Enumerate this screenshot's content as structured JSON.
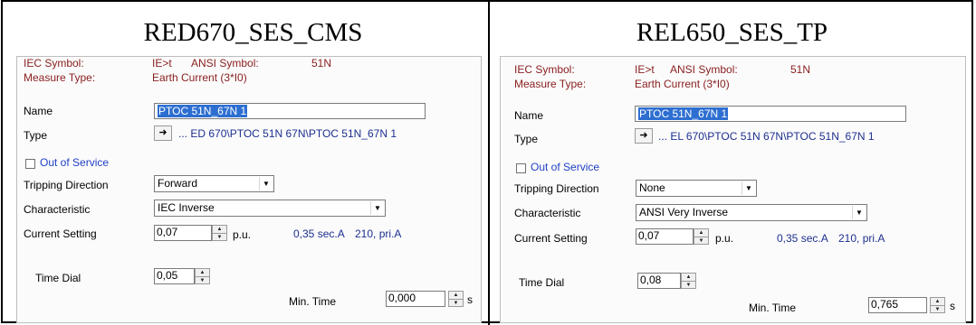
{
  "left": {
    "title": "RED670_SES_CMS",
    "iec_symbol_label": "IEC Symbol:",
    "iec_symbol_value": "IE>t",
    "ansi_symbol_label": "ANSI Symbol:",
    "ansi_symbol_value": "51N",
    "measure_type_label": "Measure Type:",
    "measure_type_value": "Earth Current (3*I0)",
    "name_label": "Name",
    "name_value": "PTOC 51N_67N 1",
    "type_label": "Type",
    "type_nav_icon": "arrow-right-icon",
    "type_value": "... ED 670\\PTOC 51N 67N\\PTOC 51N_67N 1",
    "out_of_service_label": "Out of Service",
    "tripping_direction_label": "Tripping Direction",
    "tripping_direction_value": "Forward",
    "characteristic_label": "Characteristic",
    "characteristic_value": "IEC Inverse",
    "current_setting_label": "Current Setting",
    "current_setting_value": "0,07",
    "current_unit": "p.u.",
    "current_secondary": "0,35 sec.A",
    "current_primary": "210, pri.A",
    "time_dial_label": "Time Dial",
    "time_dial_value": "0,05",
    "min_time_label": "Min. Time",
    "min_time_value": "0,000",
    "min_time_unit": "s"
  },
  "right": {
    "title": "REL650_SES_TP",
    "iec_symbol_label": "IEC Symbol:",
    "iec_symbol_value": "IE>t",
    "ansi_symbol_label": "ANSI Symbol:",
    "ansi_symbol_value": "51N",
    "measure_type_label": "Measure Type:",
    "measure_type_value": "Earth Current (3*I0)",
    "name_label": "Name",
    "name_value": "PTOC 51N_67N 1",
    "type_label": "Type",
    "type_nav_icon": "arrow-right-icon",
    "type_value": "... EL 670\\PTOC 51N 67N\\PTOC 51N_67N 1",
    "out_of_service_label": "Out of Service",
    "tripping_direction_label": "Tripping Direction",
    "tripping_direction_value": "None",
    "characteristic_label": "Characteristic",
    "characteristic_value": "ANSI Very Inverse",
    "current_setting_label": "Current Setting",
    "current_setting_value": "0,07",
    "current_unit": "p.u.",
    "current_secondary": "0,35 sec.A",
    "current_primary": "210, pri.A",
    "time_dial_label": "Time Dial",
    "time_dial_value": "0,08",
    "min_time_label": "Min. Time",
    "min_time_value": "0,765",
    "min_time_unit": "s"
  },
  "colors": {
    "header_label": "#8a2020",
    "link_blue": "#1f3fc4",
    "selection": "#2d6ed1"
  }
}
